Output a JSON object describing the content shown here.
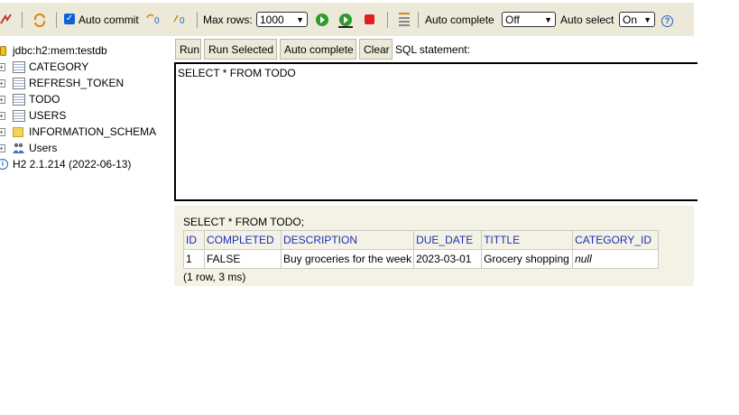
{
  "toolbar": {
    "auto_commit_label": "Auto commit",
    "max_rows_label": "Max rows:",
    "max_rows_value": "1000",
    "auto_complete_label": "Auto complete",
    "auto_complete_value": "Off",
    "auto_select_label": "Auto select",
    "auto_select_value": "On",
    "help_glyph": "?"
  },
  "tree": {
    "connection": "jdbc:h2:mem:testdb",
    "tables": [
      "CATEGORY",
      "REFRESH_TOKEN",
      "TODO",
      "USERS"
    ],
    "schema": "INFORMATION_SCHEMA",
    "users": "Users",
    "version": "H2 2.1.214 (2022-06-13)"
  },
  "query": {
    "run": "Run",
    "run_selected": "Run Selected",
    "auto_complete": "Auto complete",
    "clear": "Clear",
    "sql_label": "SQL statement:",
    "sql_text": "SELECT * FROM TODO"
  },
  "result": {
    "statement": "SELECT * FROM TODO;",
    "columns": [
      "ID",
      "COMPLETED",
      "DESCRIPTION",
      "DUE_DATE",
      "TITTLE",
      "CATEGORY_ID"
    ],
    "rows": [
      [
        "1",
        "FALSE",
        "Buy groceries for the week",
        "2023-03-01",
        "Grocery shopping",
        "null"
      ]
    ],
    "summary": "(1 row, 3 ms)"
  }
}
